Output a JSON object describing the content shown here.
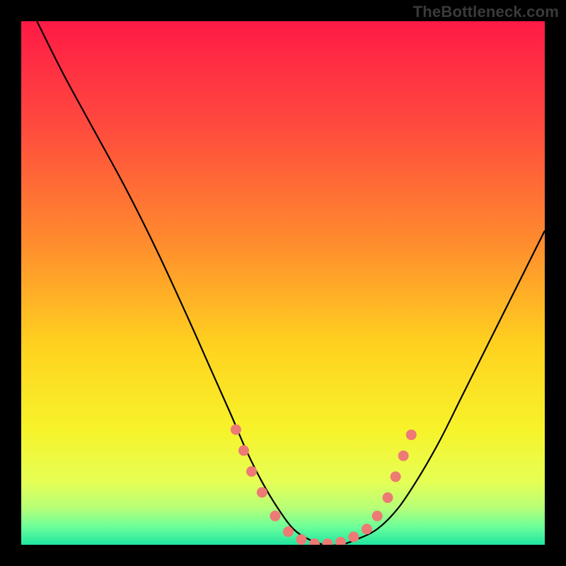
{
  "watermark": "TheBottleneck.com",
  "colors": {
    "background": "#000000",
    "curve": "#000000",
    "dots": "#ed7a74",
    "gradient_stops": [
      {
        "offset": 0.0,
        "color": "#ff1a46"
      },
      {
        "offset": 0.2,
        "color": "#ff4a3e"
      },
      {
        "offset": 0.42,
        "color": "#ff8b2e"
      },
      {
        "offset": 0.62,
        "color": "#ffd21f"
      },
      {
        "offset": 0.78,
        "color": "#f7f32a"
      },
      {
        "offset": 0.88,
        "color": "#e5ff55"
      },
      {
        "offset": 0.93,
        "color": "#b6ff77"
      },
      {
        "offset": 0.965,
        "color": "#6dff9a"
      },
      {
        "offset": 1.0,
        "color": "#1fe6a0"
      }
    ]
  },
  "chart_data": {
    "type": "line",
    "title": "",
    "xlabel": "",
    "ylabel": "",
    "xlim": [
      0,
      100
    ],
    "ylim": [
      0,
      100
    ],
    "series": [
      {
        "name": "bottleneck-curve",
        "x": [
          3,
          8,
          14,
          20,
          26,
          32,
          36,
          40,
          43,
          46,
          49,
          52,
          55,
          58,
          61,
          64,
          68,
          72,
          76,
          80,
          84,
          88,
          92,
          96,
          100
        ],
        "y": [
          100,
          90,
          79,
          68,
          56,
          43,
          34,
          25,
          18,
          12,
          7,
          3,
          1,
          0,
          0,
          1,
          3,
          7,
          13,
          20,
          28,
          36,
          44,
          52,
          60
        ]
      }
    ],
    "dots": {
      "name": "highlight-dots",
      "x": [
        41,
        42.5,
        44,
        46,
        48.5,
        51,
        53.5,
        56,
        58.5,
        61,
        63.5,
        66,
        68,
        70,
        71.5,
        73,
        74.5
      ],
      "y": [
        22,
        18,
        14,
        10,
        5.5,
        2.5,
        1,
        0.2,
        0.2,
        0.5,
        1.5,
        3,
        5.5,
        9,
        13,
        17,
        21
      ]
    }
  }
}
